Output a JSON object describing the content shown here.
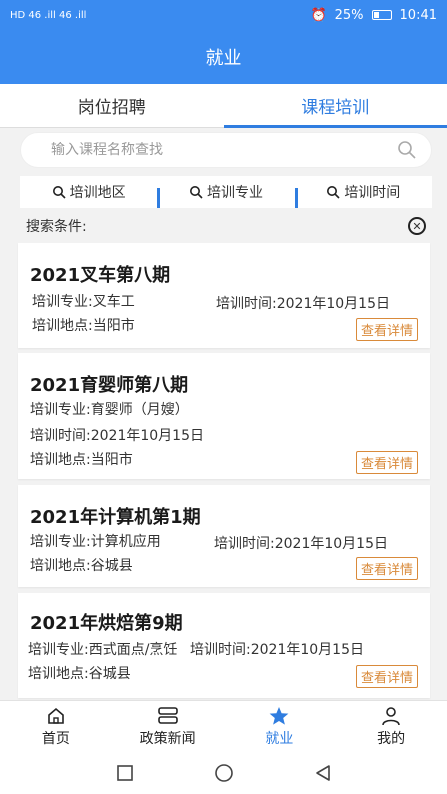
{
  "status_bar": {
    "left_text": "HD 46 .ill 46 .ill",
    "battery_percent": "25%",
    "time": "10:41"
  },
  "header": {
    "title": "就业"
  },
  "tabs": [
    {
      "label": "岗位招聘",
      "active": false
    },
    {
      "label": "课程培训",
      "active": true
    }
  ],
  "search": {
    "placeholder": "输入课程名称查找",
    "icon": "search-icon"
  },
  "filters": [
    {
      "label": "培训地区",
      "icon": "search-icon"
    },
    {
      "label": "培训专业",
      "icon": "search-icon"
    },
    {
      "label": "培训时间",
      "icon": "search-icon"
    }
  ],
  "conditions": {
    "label": "搜索条件:"
  },
  "courses": [
    {
      "title": "2021叉车第八期",
      "major": "培训专业:叉车工",
      "time": "培训时间:2021年10月15日",
      "location": "培训地点:当阳市",
      "detail": "查看详情"
    },
    {
      "title": "2021育婴师第八期",
      "major": "培训专业:育婴师（月嫂）",
      "time": "培训时间:2021年10月15日",
      "location": "培训地点:当阳市",
      "detail": "查看详情"
    },
    {
      "title": "2021年计算机第1期",
      "major": "培训专业:计算机应用",
      "time": "培训时间:2021年10月15日",
      "location": "培训地点:谷城县",
      "detail": "查看详情"
    },
    {
      "title": "2021年烘焙第9期",
      "major": "培训专业:西式面点/烹饪",
      "time": "培训时间:2021年10月15日",
      "location": "培训地点:谷城县",
      "detail": "查看详情"
    }
  ],
  "bottom_nav": [
    {
      "label": "首页",
      "icon": "home-icon",
      "active": false
    },
    {
      "label": "政策新闻",
      "icon": "news-icon",
      "active": false
    },
    {
      "label": "就业",
      "icon": "star-icon",
      "active": true
    },
    {
      "label": "我的",
      "icon": "user-icon",
      "active": false
    }
  ],
  "colors": {
    "primary": "#3a8bf0",
    "active_tab": "#2f7de0",
    "detail_button": "#d98a3a"
  }
}
